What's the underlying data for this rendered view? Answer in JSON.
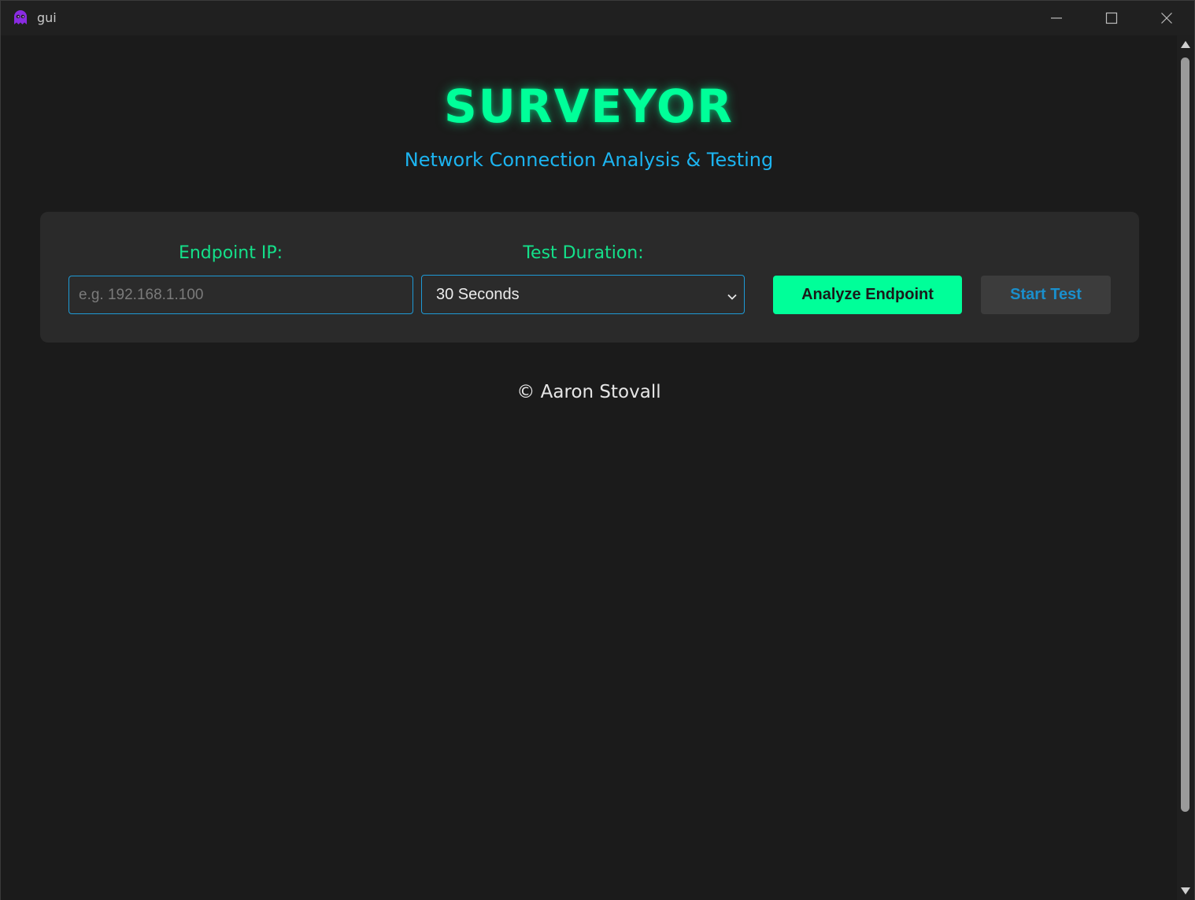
{
  "window": {
    "title": "gui",
    "icons": {
      "app": "ghost-app-icon",
      "minimize": "minimize-icon",
      "maximize": "maximize-icon",
      "close": "close-icon"
    }
  },
  "header": {
    "title": "SURVEYOR",
    "subtitle": "Network Connection Analysis & Testing"
  },
  "form": {
    "endpoint_label": "Endpoint IP:",
    "endpoint_placeholder": "e.g. 192.168.1.100",
    "endpoint_value": "",
    "duration_label": "Test Duration:",
    "duration_selected": "30 Seconds",
    "analyze_button": "Analyze Endpoint",
    "start_button": "Start Test"
  },
  "footer": {
    "text": "© Aaron Stovall"
  },
  "colors": {
    "accent_green": "#00ff99",
    "accent_blue": "#1cb4f0",
    "background": "#1b1b1b",
    "panel": "#2a2a2a"
  }
}
